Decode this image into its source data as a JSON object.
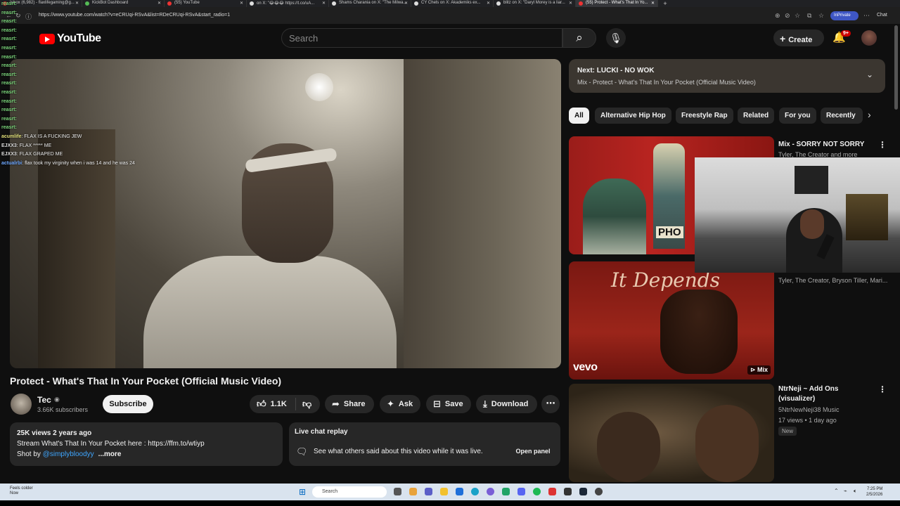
{
  "browser": {
    "tabs": [
      {
        "label": "Inbox (6,982) - flaxlifegaming@g..."
      },
      {
        "label": "KickBot Dashboard"
      },
      {
        "label": "(55) YouTube"
      },
      {
        "label": "on X: \"😂😂😂 https://t.co/uA..."
      },
      {
        "label": "Shams Charania on X: \"The Milwa..."
      },
      {
        "label": "CY Chels on X: Akademiks ex..."
      },
      {
        "label": "blitz on X: \"Daryl Morey is a liar..."
      },
      {
        "label": "(55) Protect - What's That In Yo..."
      }
    ],
    "url": "https://www.youtube.com/watch?v=eCRUqi-RSvA&list=RDeCRUqi-RSvA&start_radio=1",
    "inprivate_label": "InPrivate",
    "chat_label": "Chat"
  },
  "header": {
    "logo_text": "YouTube",
    "search_placeholder": "Search",
    "create_label": "Create",
    "notification_count": "9+"
  },
  "chat_overlay": {
    "reasrt_lines": [
      "reasrt:",
      "reasrt:",
      "reasrt:",
      "reasrt:",
      "reasrt:",
      "reasrt:",
      "reasrt:",
      "reasrt:",
      "reasrt:",
      "reasrt:",
      "reasrt:",
      "reasrt:",
      "reasrt:",
      "reasrt:",
      "reasrt:"
    ],
    "messages": [
      {
        "user": "acumlife",
        "text": "FLAX IS A FUCKING JEW"
      },
      {
        "user": "EJXX3",
        "text": "FLAX ***** ME"
      },
      {
        "user": "EJXX3",
        "text": "FLAX GRAPED ME"
      },
      {
        "user": "actualrbi",
        "text": "flax took my virginity when i was 14 and he was 24"
      }
    ]
  },
  "video": {
    "title": "Protect - What's That In Your Pocket (Official Music Video)",
    "channel": "Tec",
    "subscribers": "3.66K subscribers",
    "subscribe_label": "Subscribe",
    "likes": "1.1K",
    "share_label": "Share",
    "ask_label": "Ask",
    "save_label": "Save",
    "download_label": "Download"
  },
  "description": {
    "meta": "25K views  2 years ago",
    "line1": "Stream  What's That In Your Pocket  here : https://ffm.to/wtiyp",
    "shot_by_prefix": "Shot by ",
    "shot_by_link": "@simplybloodyy",
    "more_label": "...more"
  },
  "live_chat": {
    "title": "Live chat replay",
    "text": "See what others said about this video while it was live.",
    "open_panel_label": "Open panel"
  },
  "next_card": {
    "label": "Next: LUCKI - NO WOK",
    "sub": "Mix - Protect - What's That In Your Pocket (Official Music Video)"
  },
  "chips": [
    "All",
    "Alternative Hip Hop",
    "Freestyle Rap",
    "Related",
    "For you",
    "Recently"
  ],
  "recommendations": [
    {
      "title": "Mix - SORRY NOT SORRY",
      "sub": "Tyler, The Creator and more",
      "thumb_sign": "PHO"
    },
    {
      "title": "",
      "sub": "Tyler, The Creator, Bryson Tiller, Mari...",
      "thumb_script": "It Depends",
      "thumb_brand": "vevo",
      "badge": "Mix"
    },
    {
      "title": "NtrNeji ~ Add Ons (visualizer)",
      "channel": "5NtrNewNeji38 Music",
      "stats": "17 views • 1 day ago",
      "badge": "New"
    }
  ],
  "taskbar": {
    "weather_line1": "Feels colder",
    "weather_line2": "Now",
    "search_label": "Search",
    "time": "7:25 PM",
    "date": "2/5/2026"
  },
  "colors": {
    "accent_red": "#ff0000",
    "link_blue": "#3ea6ff",
    "background": "#0f0f0f"
  }
}
